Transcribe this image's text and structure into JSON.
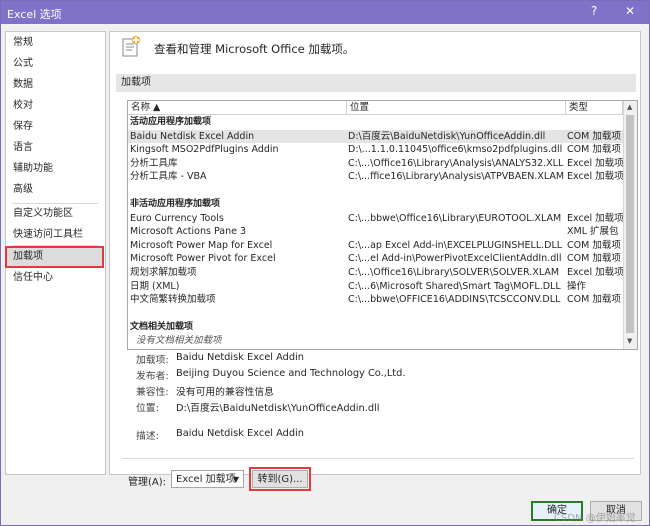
{
  "window": {
    "title": "Excel 选项",
    "help": "?",
    "close": "✕"
  },
  "sidebar": {
    "items": [
      {
        "label": "常规"
      },
      {
        "label": "公式"
      },
      {
        "label": "数据"
      },
      {
        "label": "校对"
      },
      {
        "label": "保存"
      },
      {
        "label": "语言"
      },
      {
        "label": "辅助功能"
      },
      {
        "label": "高级"
      },
      {
        "label": "自定义功能区"
      },
      {
        "label": "快速访问工具栏"
      },
      {
        "label": "加载项"
      },
      {
        "label": "信任中心"
      }
    ],
    "active": "加载项"
  },
  "main": {
    "heading": "查看和管理 Microsoft Office 加载项。",
    "section": "加载项",
    "columns": {
      "name": "名称 ▲",
      "location": "位置",
      "type": "类型"
    },
    "rows": [
      {
        "group": "活动应用程序加载项"
      },
      {
        "name": "Baidu Netdisk Excel Addin",
        "location": "D:\\百度云\\BaiduNetdisk\\YunOfficeAddin.dll",
        "type": "COM 加载项"
      },
      {
        "name": "Kingsoft MSO2PdfPlugins Addin",
        "location": "D:\\...1.1.0.11045\\office6\\kmso2pdfplugins.dll",
        "type": "COM 加载项"
      },
      {
        "name": "分析工具库",
        "location": "C:\\...\\Office16\\Library\\Analysis\\ANALYS32.XLL",
        "type": "Excel 加载项"
      },
      {
        "name": "分析工具库 - VBA",
        "location": "C:\\...ffice16\\Library\\Analysis\\ATPVBAEN.XLAM",
        "type": "Excel 加载项"
      },
      {
        "blank": ""
      },
      {
        "group": "非活动应用程序加载项"
      },
      {
        "name": "Euro Currency Tools",
        "location": "C:\\...bbwe\\Office16\\Library\\EUROTOOL.XLAM",
        "type": "Excel 加载项"
      },
      {
        "name": "Microsoft Actions Pane 3",
        "location": "",
        "type": "XML 扩展包"
      },
      {
        "name": "Microsoft Power Map for Excel",
        "location": "C:\\...ap Excel Add-in\\EXCELPLUGINSHELL.DLL",
        "type": "COM 加载项"
      },
      {
        "name": "Microsoft Power Pivot for Excel",
        "location": "C:\\...el Add-in\\PowerPivotExcelClientAddIn.dll",
        "type": "COM 加载项"
      },
      {
        "name": "规划求解加载项",
        "location": "C:\\...\\Office16\\Library\\SOLVER\\SOLVER.XLAM",
        "type": "Excel 加载项"
      },
      {
        "name": "日期 (XML)",
        "location": "C:\\...6\\Microsoft Shared\\Smart Tag\\MOFL.DLL",
        "type": "操作"
      },
      {
        "name": "中文简繁转换加载项",
        "location": "C:\\...bbwe\\OFFICE16\\ADDINS\\TCSCCONV.DLL",
        "type": "COM 加载项"
      },
      {
        "blank": ""
      },
      {
        "group": "文档相关加载项"
      },
      {
        "italic": "没有文档相关加载项"
      }
    ],
    "details": {
      "addin_key": "加载项:",
      "addin": "Baidu Netdisk Excel Addin",
      "publisher_key": "发布者:",
      "publisher": "Beijing Duyou Science and Technology Co.,Ltd.",
      "compat_key": "兼容性:",
      "compat": "没有可用的兼容性信息",
      "location_key": "位置:",
      "location": "D:\\百度云\\BaiduNetdisk\\YunOfficeAddin.dll",
      "desc_key": "描述:",
      "desc": "Baidu Netdisk Excel Addin"
    },
    "manage_label": "管理(A):",
    "manage_value": "Excel 加载项",
    "go_label": "转到(G)..."
  },
  "footer": {
    "ok": "确定",
    "cancel": "取消",
    "watermark": "CSDN @伊始率觉"
  }
}
